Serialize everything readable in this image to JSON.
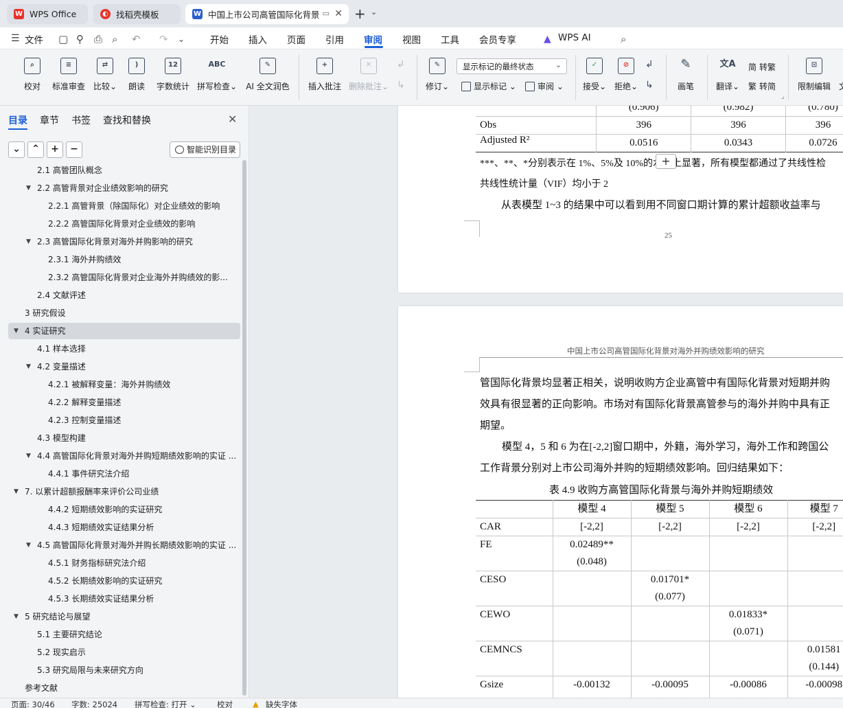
{
  "tabs": [
    {
      "label": "WPS Office"
    },
    {
      "label": "找稻壳模板"
    },
    {
      "label": "中国上市公司高管国际化背景"
    }
  ],
  "menu": {
    "file": "文件",
    "items": [
      "开始",
      "插入",
      "页面",
      "引用",
      "审阅",
      "视图",
      "工具",
      "会员专享"
    ],
    "active": "审阅",
    "ai": "WPS AI"
  },
  "ribbon": {
    "proofread": "校对",
    "std_review": "标准审查",
    "compare": "比较",
    "read_aloud": "朗读",
    "word_count": "字数统计",
    "word_count_icon": "12",
    "spell_check": "拼写检查",
    "spell_icon": "ABC",
    "ai_polish": "AI 全文润色",
    "insert_comment": "插入批注",
    "delete_comment": "删除批注",
    "track": "修订",
    "display_select": "显示标记的最终状态",
    "show_markup": "显示标记",
    "review_pane": "审阅",
    "accept": "接受",
    "reject": "拒绝",
    "ink": "画笔",
    "translate": "翻译",
    "to_traditional": "转繁",
    "to_simplified": "转简",
    "restrict_edit": "限制编辑",
    "cut_char": "文"
  },
  "nav": {
    "tabs": [
      "目录",
      "章节",
      "书签",
      "查找和替换"
    ],
    "smart_btn": "智能识别目录",
    "toc": [
      {
        "text": "2.1 高管团队概念",
        "level": 2,
        "arrow": ""
      },
      {
        "text": "2.2 高管背景对企业绩效影响的研究",
        "level": 2,
        "arrow": "▼"
      },
      {
        "text": "2.2.1 高管背景（除国际化）对企业绩效的影响",
        "level": 3,
        "arrow": ""
      },
      {
        "text": "2.2.2 高管国际化背景对企业绩效的影响",
        "level": 3,
        "arrow": ""
      },
      {
        "text": "2.3 高管国际化背景对海外并购影响的研究",
        "level": 2,
        "arrow": "▼"
      },
      {
        "text": "2.3.1 海外并购绩效",
        "level": 3,
        "arrow": ""
      },
      {
        "text": "2.3.2 高管国际化背景对企业海外并购绩效的影...",
        "level": 3,
        "arrow": ""
      },
      {
        "text": "2.4 文献评述",
        "level": 2,
        "arrow": ""
      },
      {
        "text": "3 研究假设",
        "level": 1,
        "arrow": ""
      },
      {
        "text": "4 实证研究",
        "level": 1,
        "arrow": "▼",
        "highlight": true
      },
      {
        "text": "4.1 样本选择",
        "level": 2,
        "arrow": ""
      },
      {
        "text": "4.2 变量描述",
        "level": 2,
        "arrow": "▼"
      },
      {
        "text": "4.2.1 被解释变量：海外并购绩效",
        "level": 3,
        "arrow": ""
      },
      {
        "text": "4.2.2 解释变量描述",
        "level": 3,
        "arrow": ""
      },
      {
        "text": "4.2.3 控制变量描述",
        "level": 3,
        "arrow": ""
      },
      {
        "text": "4.3 模型构建",
        "level": 2,
        "arrow": ""
      },
      {
        "text": "4.4 高管国际化背景对海外并购短期绩效影响的实证 ...",
        "level": 2,
        "arrow": "▼"
      },
      {
        "text": "4.4.1 事件研究法介绍",
        "level": 3,
        "arrow": ""
      },
      {
        "text": "7. 以累计超额报酬率来评价公司业绩",
        "level": 1,
        "arrow": "▼"
      },
      {
        "text": "4.4.2 短期绩效影响的实证研究",
        "level": 3,
        "arrow": ""
      },
      {
        "text": "4.4.3 短期绩效实证结果分析",
        "level": 3,
        "arrow": ""
      },
      {
        "text": "4.5 高管国际化背景对海外并购长期绩效影响的实证 ...",
        "level": 2,
        "arrow": "▼"
      },
      {
        "text": "4.5.1 财务指标研究法介绍",
        "level": 3,
        "arrow": ""
      },
      {
        "text": "4.5.2 长期绩效影响的实证研究",
        "level": 3,
        "arrow": ""
      },
      {
        "text": "4.5.3 长期绩效实证结果分析",
        "level": 3,
        "arrow": ""
      },
      {
        "text": "5 研究结论与展望",
        "level": 1,
        "arrow": "▼"
      },
      {
        "text": "5.1 主要研究结论",
        "level": 2,
        "arrow": ""
      },
      {
        "text": "5.2 现实启示",
        "level": 2,
        "arrow": ""
      },
      {
        "text": "5.3 研究局限与未来研究方向",
        "level": 2,
        "arrow": ""
      },
      {
        "text": "参考文献",
        "level": 1,
        "arrow": ""
      }
    ]
  },
  "page1": {
    "rows": [
      [
        "",
        "(0.906)",
        "(0.982)",
        "(0.780)"
      ],
      [
        "Obs",
        "396",
        "396",
        "396"
      ],
      [
        "Adjusted R²",
        "0.0516",
        "0.0343",
        "0.0726"
      ]
    ],
    "note_line1": "***、**、*分别表示在 1%、5%及 10%的水平上显著，所有模型都通过了共线性检",
    "note_line2": "共线性统计量（VIF）均小于 2",
    "para": "从表模型 1~3 的结果中可以看到用不同窗口期计算的累计超额收益率与",
    "page_no": "25"
  },
  "page2": {
    "header": "中国上市公司高管国际化背景对海外并购绩效影响的研究",
    "lines": [
      "管国际化背景均显著正相关，说明收购方企业高管中有国际化背景对短期并购",
      "效具有很显著的正向影响。市场对有国际化背景高管参与的海外并购中具有正",
      "期望。",
      "模型 4，5 和 6 为在[-2,2]窗口期中，外籍，海外学习，海外工作和跨国公",
      "工作背景分别对上市公司海外并购的短期绩效影响。回归结果如下："
    ],
    "table_title": "表 4.9  收购方高管国际化背景与海外并购短期绩效",
    "columns": [
      "",
      "模型 4",
      "模型 5",
      "模型 6",
      "模型 7"
    ],
    "rows": [
      [
        "CAR",
        "[-2,2]",
        "[-2,2]",
        "[-2,2]",
        "[-2,2]"
      ],
      [
        "FE",
        "0.02489**\n(0.048)",
        "",
        "",
        ""
      ],
      [
        "CESO",
        "",
        "0.01701*\n(0.077)",
        "",
        ""
      ],
      [
        "CEWO",
        "",
        "",
        "0.01833*\n(0.071)",
        ""
      ],
      [
        "CEMNCS",
        "",
        "",
        "",
        "0.01581\n(0.144)"
      ],
      [
        "Gsize",
        "-0.00132\n(0.317)",
        "-0.00095\n(0.467)",
        "-0.00086\n(0.508)",
        "-0.00098\n(0.437)"
      ]
    ]
  },
  "status": {
    "page": "页面: 30/46",
    "words": "字数: 25024",
    "spell": "拼写检查: 打开",
    "proof": "校对",
    "missing_font": "缺失字体"
  },
  "colors": {
    "accent": "#1a5fd6",
    "wps_red": "#e8322a",
    "word_blue": "#2b5fce"
  }
}
